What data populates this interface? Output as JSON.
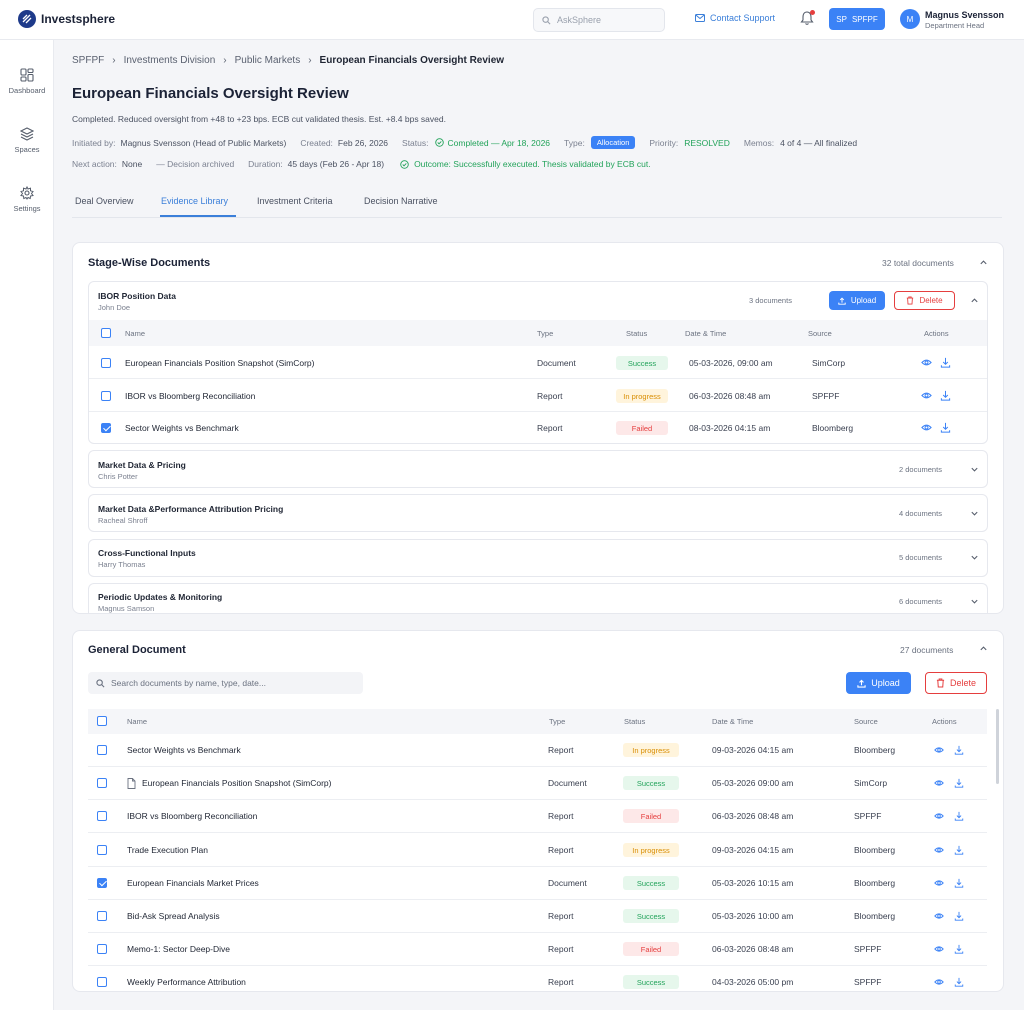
{
  "app": {
    "name": "Investsphere"
  },
  "header": {
    "search_placeholder": "AskSphere",
    "contact_label": "Contact Support",
    "org_initials": "SP",
    "org_label": "SPFPF",
    "user_initial": "M",
    "user_name": "Magnus Svensson",
    "user_role": "Department Head"
  },
  "sidebar": {
    "items": [
      {
        "label": "Dashboard",
        "icon": "dashboard-icon"
      },
      {
        "label": "Spaces",
        "icon": "layers-icon"
      },
      {
        "label": "Settings",
        "icon": "gear-icon"
      }
    ]
  },
  "breadcrumb": [
    "SPFPF",
    "Investments Division",
    "Public Markets",
    "European Financials Oversight Review"
  ],
  "page": {
    "title": "European Financials Oversight Review",
    "summary": "Completed. Reduced oversight from +48 to +23 bps. ECB cut validated thesis. Est. +8.4 bps saved.",
    "initiated_label": "Initiated by:",
    "initiated_value": "Magnus Svensson (Head of Public Markets)",
    "created_label": "Created:",
    "created_value": "Feb 26, 2026",
    "status_label": "Status:",
    "status_value": "Completed — Apr 18, 2026",
    "type_label": "Type:",
    "type_value": "Allocation",
    "priority_label": "Priority:",
    "priority_value": "RESOLVED",
    "memos_label": "Memos:",
    "memos_value": "4 of 4 — All finalized",
    "next_action_label": "Next action:",
    "next_action_value": "None",
    "decision_label": "— Decision archived",
    "duration_label": "Duration:",
    "duration_value": "45 days (Feb 26 - Apr 18)",
    "outcome": "Outcome: Successfully executed. Thesis validated by ECB cut."
  },
  "tabs": [
    "Deal Overview",
    "Evidence Library",
    "Investment Criteria",
    "Decision Narrative"
  ],
  "stage_docs": {
    "title": "Stage-Wise Documents",
    "total": "32 total documents",
    "open_group": {
      "title": "IBOR Position Data",
      "owner": "John Doe",
      "count": "3 documents",
      "upload": "Upload",
      "delete": "Delete",
      "columns": [
        "Name",
        "Type",
        "Status",
        "Date & Time",
        "Source",
        "Actions"
      ],
      "rows": [
        {
          "name": "European Financials Position Snapshot (SimCorp)",
          "type": "Document",
          "status": "Success",
          "date": "05-03-2026, 09:00 am",
          "source": "SimCorp"
        },
        {
          "name": "IBOR vs Bloomberg Reconciliation",
          "type": "Report",
          "status": "In progress",
          "date": "06-03-2026 08:48 am",
          "source": "SPFPF"
        },
        {
          "name": "Sector Weights vs Benchmark",
          "type": "Report",
          "status": "Failed",
          "date": "08-03-2026 04:15 am",
          "source": "Bloomberg"
        }
      ]
    },
    "groups": [
      {
        "title": "Market Data & Pricing",
        "owner": "Chris Potter",
        "count": "2 documents"
      },
      {
        "title": "Market Data &Performance Attribution Pricing",
        "owner": "Racheal Shroff",
        "count": "4 documents"
      },
      {
        "title": "Cross-Functional Inputs",
        "owner": "Harry Thomas",
        "count": "5 documents"
      },
      {
        "title": "Periodic Updates & Monitoring",
        "owner": "Magnus Samson",
        "count": "6 documents"
      }
    ]
  },
  "general_docs": {
    "title": "General Document",
    "count": "27 documents",
    "search_placeholder": "Search documents by name, type, date...",
    "upload": "Upload",
    "delete": "Delete",
    "columns": [
      "Name",
      "Type",
      "Status",
      "Date & Time",
      "Source",
      "Actions"
    ],
    "rows": [
      {
        "name": "Sector Weights vs Benchmark",
        "type": "Report",
        "status": "In progress",
        "date": "09-03-2026 04:15 am",
        "source": "Bloomberg"
      },
      {
        "name": "European Financials Position Snapshot (SimCorp)",
        "type": "Document",
        "status": "Success",
        "date": "05-03-2026 09:00 am",
        "source": "SimCorp"
      },
      {
        "name": "IBOR vs Bloomberg Reconciliation",
        "type": "Report",
        "status": "Failed",
        "date": "06-03-2026 08:48 am",
        "source": "SPFPF"
      },
      {
        "name": "Trade Execution Plan",
        "type": "Report",
        "status": "In progress",
        "date": "09-03-2026 04:15 am",
        "source": "Bloomberg"
      },
      {
        "name": "European Financials Market Prices",
        "type": "Document",
        "status": "Success",
        "date": "05-03-2026 10:15 am",
        "source": "Bloomberg"
      },
      {
        "name": "Bid-Ask Spread Analysis",
        "type": "Report",
        "status": "Success",
        "date": "05-03-2026 10:00 am",
        "source": "Bloomberg"
      },
      {
        "name": "Memo-1: Sector Deep-Dive",
        "type": "Report",
        "status": "Failed",
        "date": "06-03-2026 08:48 am",
        "source": "SPFPF"
      },
      {
        "name": "Weekly Performance Attribution",
        "type": "Report",
        "status": "Success",
        "date": "04-03-2026 05:00 pm",
        "source": "SPFPF"
      }
    ]
  }
}
